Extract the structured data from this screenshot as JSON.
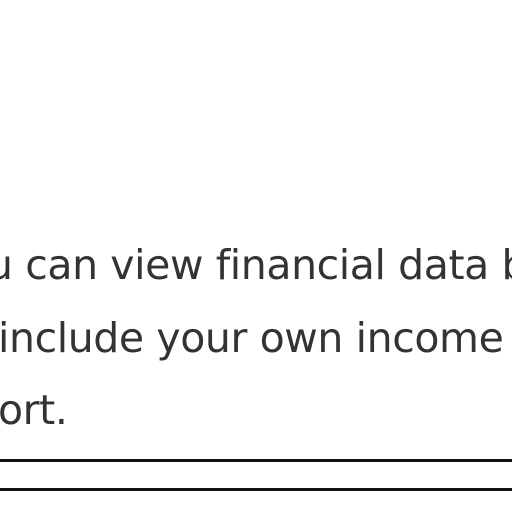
{
  "document": {
    "lines": [
      "u can view financial data b",
      "include your own income",
      "ort."
    ]
  }
}
